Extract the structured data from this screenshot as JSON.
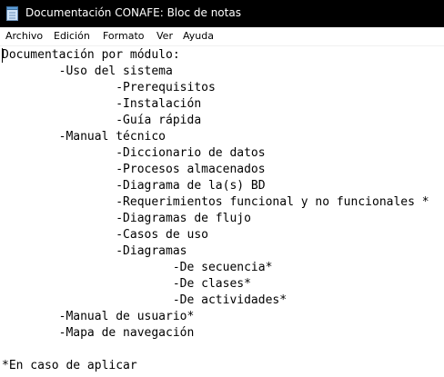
{
  "window": {
    "title": "Documentación CONAFE: Bloc de notas",
    "icon": "notepad-icon"
  },
  "menu": {
    "items": [
      "Archivo",
      "Edición",
      "Formato",
      "Ver",
      "Ayuda"
    ]
  },
  "document": {
    "lines": [
      "Documentación por módulo:",
      "        -Uso del sistema",
      "                -Prerequisitos",
      "                -Instalación",
      "                -Guía rápida",
      "        -Manual técnico",
      "                -Diccionario de datos",
      "                -Procesos almacenados",
      "                -Diagrama de la(s) BD",
      "                -Requerimientos funcional y no funcionales *",
      "                -Diagramas de flujo",
      "                -Casos de uso",
      "                -Diagramas",
      "                        -De secuencia*",
      "                        -De clases*",
      "                        -De actividades*",
      "        -Manual de usuario*",
      "        -Mapa de navegación",
      "",
      "*En caso de aplicar"
    ]
  }
}
